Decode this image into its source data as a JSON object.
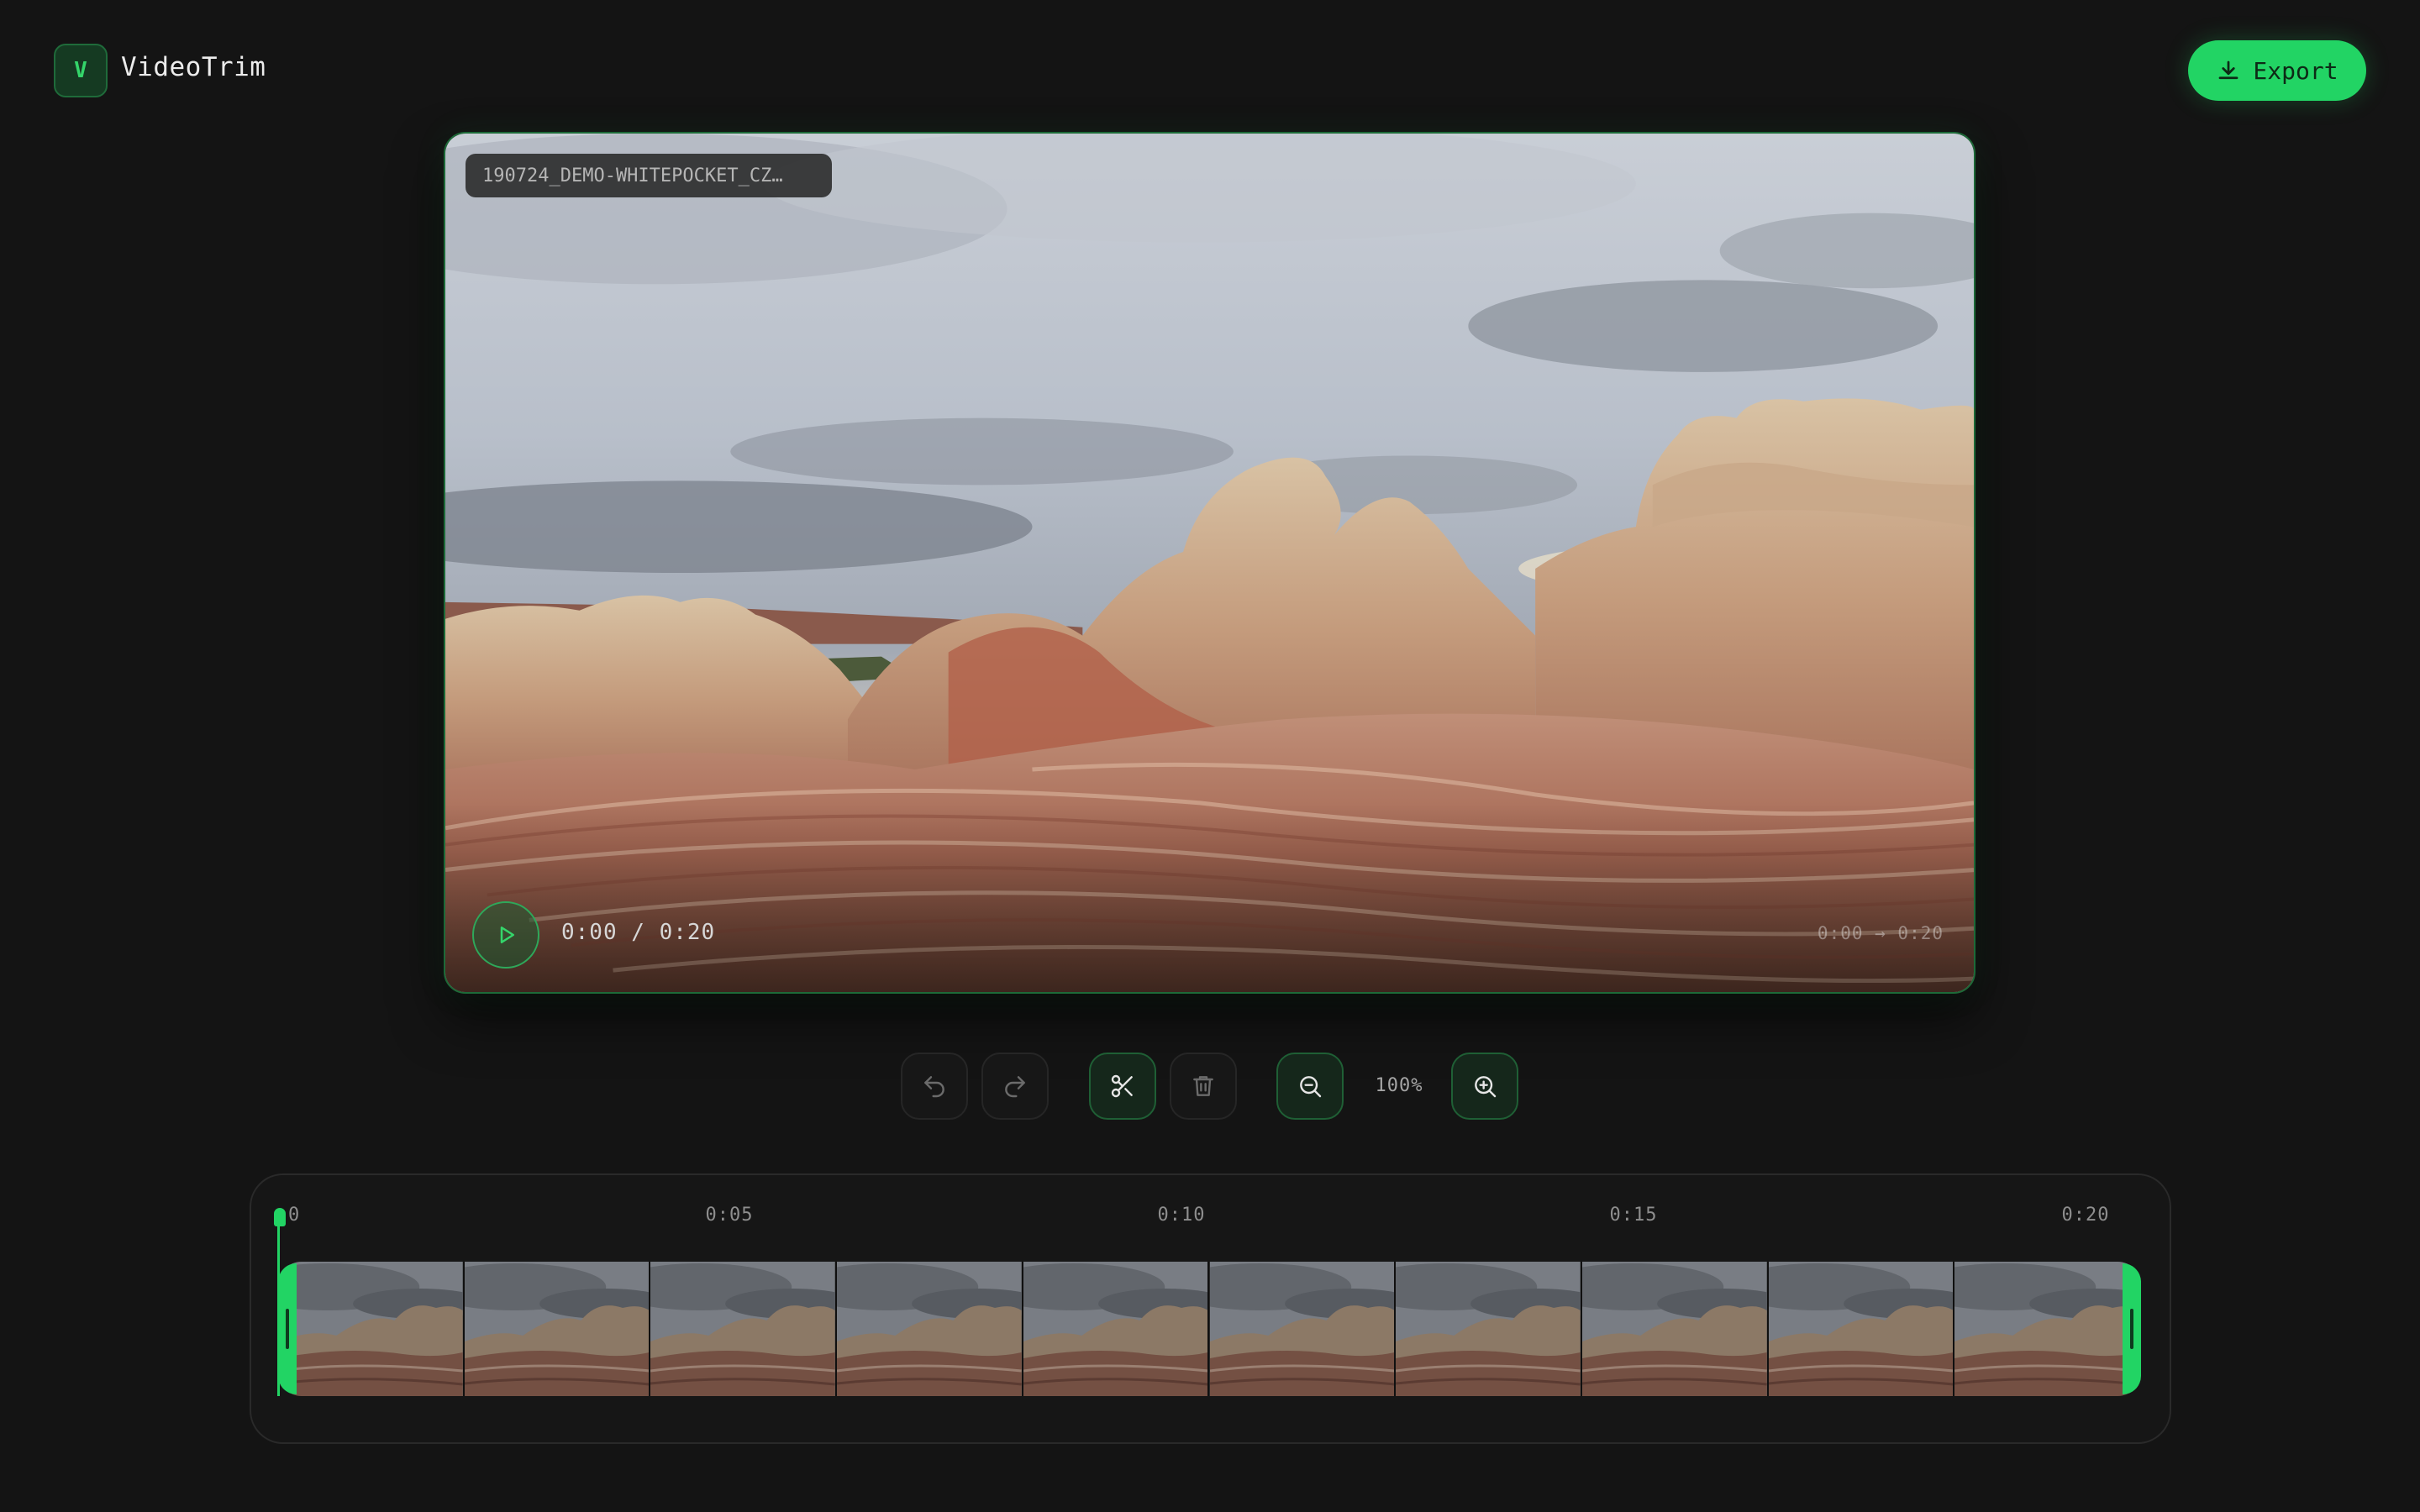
{
  "app": {
    "logo_letter": "V",
    "title": "VideoTrim"
  },
  "header": {
    "export_label": "Export",
    "export_icon": "download-icon"
  },
  "player": {
    "file_name": "190724_DEMO-WHITEPOCKET_CZ…",
    "time_display": "0:00 / 0:20",
    "range_display": "0:00 → 0:20",
    "play_icon": "play-icon"
  },
  "toolbar": {
    "undo_icon": "undo-icon",
    "redo_icon": "redo-icon",
    "split_icon": "scissors-icon",
    "delete_icon": "trash-icon",
    "zoom_out_icon": "zoom-out-icon",
    "zoom_in_icon": "zoom-in-icon",
    "zoom_level": "100%"
  },
  "timeline": {
    "ticks": [
      "0",
      "0:05",
      "0:10",
      "0:15",
      "0:20"
    ],
    "thumbnail_count": 10,
    "trim_start": "0:00",
    "trim_end": "0:20",
    "playhead": "0:00"
  },
  "colors": {
    "accent": "#22d464",
    "background": "#141414",
    "panel_border": "#2a2a2a"
  }
}
